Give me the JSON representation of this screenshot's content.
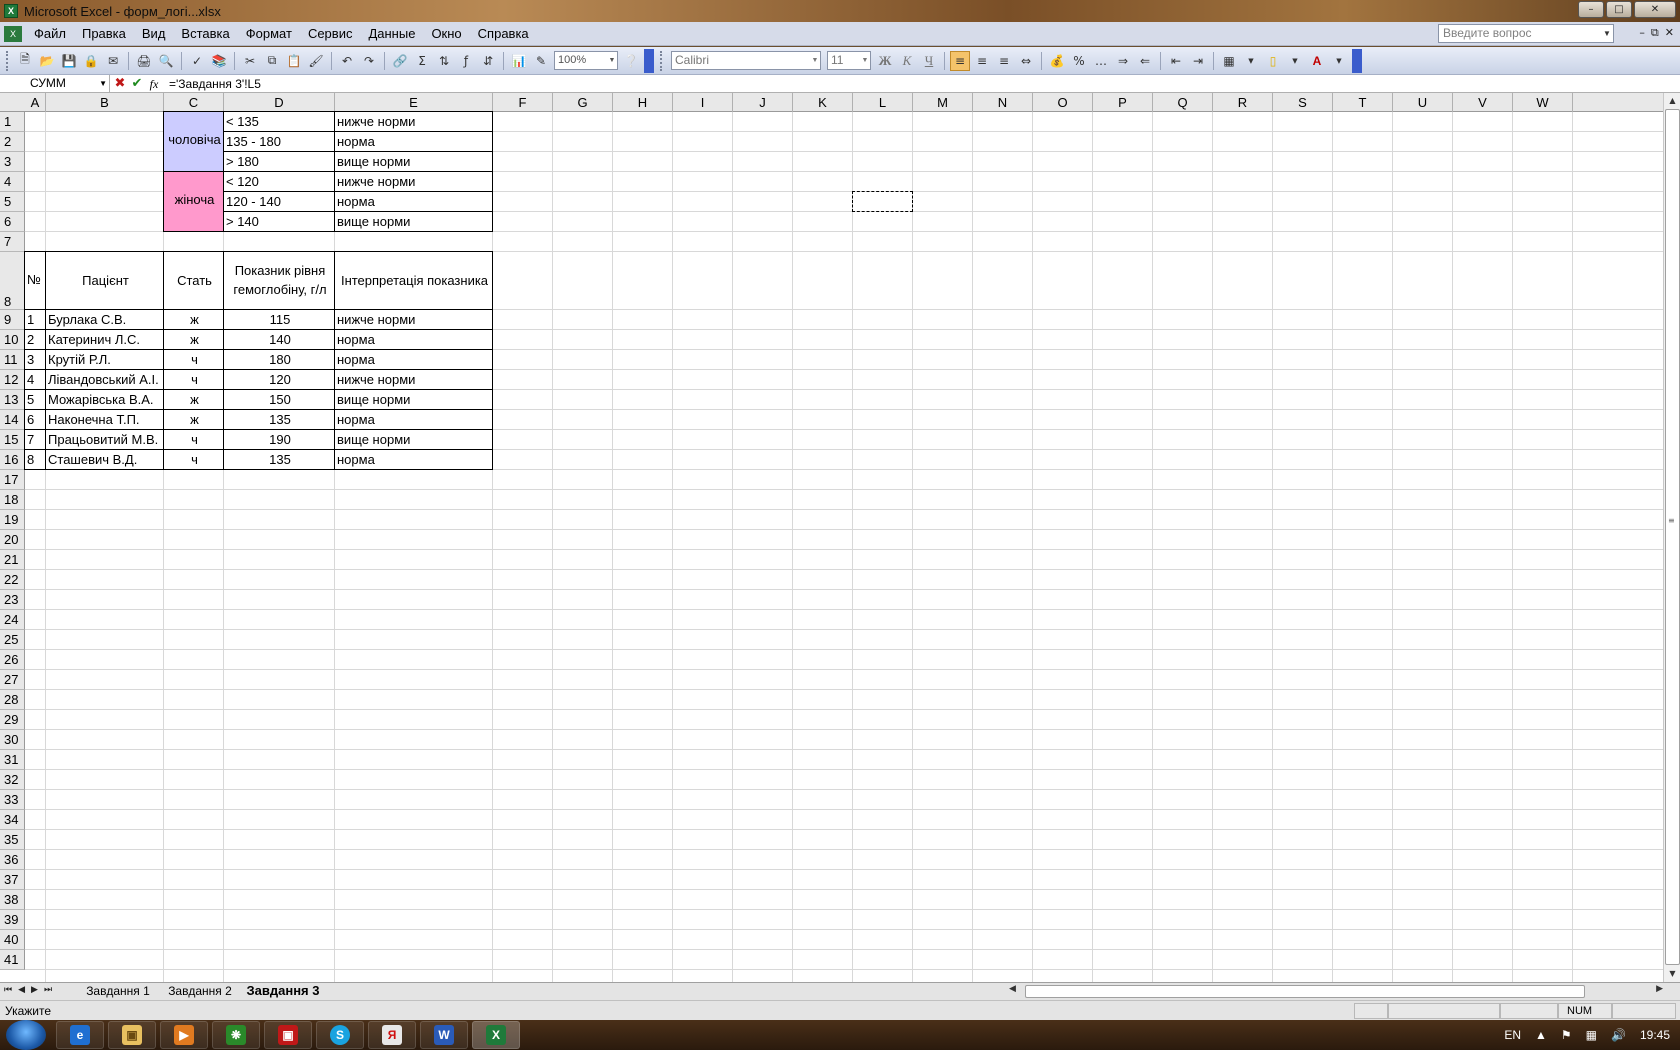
{
  "window": {
    "title": "Microsoft Excel - форм_логі...xlsx",
    "buttons": [
      "minimize",
      "maximize",
      "close"
    ]
  },
  "menubar": {
    "items": [
      "Файл",
      "Правка",
      "Вид",
      "Вставка",
      "Формат",
      "Сервис",
      "Данные",
      "Окно",
      "Справка"
    ],
    "ask_placeholder": "Введите вопрос"
  },
  "toolbar": {
    "zoom": "100%",
    "font_name": "Calibri",
    "font_size": "11",
    "bold_label": "Ж",
    "italic_label": "К",
    "underline_label": "Ч",
    "percent_label": "%",
    "sum_label": "Σ"
  },
  "formula_bar": {
    "name_box": "СУММ",
    "formula": "='Завдання 3'!L5"
  },
  "columns": [
    "A",
    "B",
    "C",
    "D",
    "E",
    "F",
    "G",
    "H",
    "I",
    "J",
    "K",
    "L",
    "M",
    "N",
    "O",
    "P",
    "Q",
    "R",
    "S",
    "T",
    "U",
    "V",
    "W"
  ],
  "rows": [
    "1",
    "2",
    "3",
    "4",
    "5",
    "6",
    "7",
    "8",
    "9",
    "10",
    "11",
    "12",
    "13",
    "14",
    "15",
    "16",
    "17",
    "18",
    "19",
    "20",
    "21",
    "22",
    "23",
    "24",
    "25",
    "26",
    "27",
    "28",
    "29",
    "30",
    "31",
    "32",
    "33",
    "34",
    "35",
    "36",
    "37",
    "38",
    "39",
    "40",
    "41"
  ],
  "reference_table": {
    "male_label": "чоловіча",
    "female_label": "жіноча",
    "male_rows": [
      {
        "range": "< 135",
        "meaning": "нижче норми"
      },
      {
        "range": "135 - 180",
        "meaning": "норма"
      },
      {
        "range": "> 180",
        "meaning": "вище норми"
      }
    ],
    "female_rows": [
      {
        "range": "< 120",
        "meaning": "нижче норми"
      },
      {
        "range": "120 - 140",
        "meaning": "норма"
      },
      {
        "range": "> 140",
        "meaning": "вище норми"
      }
    ],
    "male_color": "#ccccff",
    "female_color": "#ff99cc"
  },
  "patients_table": {
    "headers": {
      "num": "№",
      "patient": "Пацієнт",
      "sex": "Стать",
      "value_line1": "Показник рівня",
      "value_line2": "гемоглобіну, г/л",
      "interpretation": "Інтерпретація показника"
    },
    "rows": [
      {
        "num": "1",
        "name": "Бурлака С.В.",
        "sex": "ж",
        "value": "115",
        "interp": "нижче норми"
      },
      {
        "num": "2",
        "name": "Катеринич Л.С.",
        "sex": "ж",
        "value": "140",
        "interp": "норма"
      },
      {
        "num": "3",
        "name": "Крутій Р.Л.",
        "sex": "ч",
        "value": "180",
        "interp": "норма"
      },
      {
        "num": "4",
        "name": "Лівандовський А.І.",
        "sex": "ч",
        "value": "120",
        "interp": "нижче норми"
      },
      {
        "num": "5",
        "name": "Можарівська В.А.",
        "sex": "ж",
        "value": "150",
        "interp": "вище норми"
      },
      {
        "num": "6",
        "name": "Наконечна Т.П.",
        "sex": "ж",
        "value": "135",
        "interp": "норма"
      },
      {
        "num": "7",
        "name": "Працьовитий М.В.",
        "sex": "ч",
        "value": "190",
        "interp": "вище норми"
      },
      {
        "num": "8",
        "name": "Сташевич В.Д.",
        "sex": "ч",
        "value": "135",
        "interp": "норма"
      }
    ]
  },
  "sheet_tabs": [
    "Завдання 1",
    "Завдання 2",
    "Завдання 3"
  ],
  "active_sheet": "Завдання 3",
  "status": {
    "mode": "Укажите",
    "num": "NUM"
  },
  "taskbar": {
    "lang": "EN",
    "time": "19:45"
  }
}
